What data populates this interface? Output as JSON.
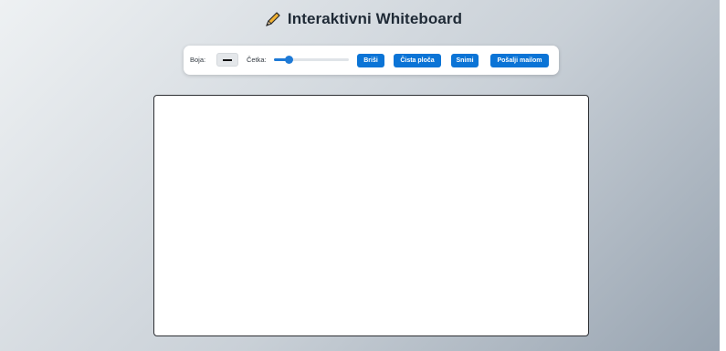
{
  "header": {
    "title": "Interaktivni Whiteboard",
    "icon": "pencil-icon"
  },
  "toolbar": {
    "color_label": "Boja:",
    "color_value": "#111111",
    "brush_label": "Četka:",
    "brush_size_fraction": 0.2,
    "buttons": {
      "erase": "Briši",
      "clear": "Čista ploča",
      "save": "Snimi",
      "email": "Pošalji mailom"
    }
  },
  "colors": {
    "accent": "#0b74d6",
    "board_background": "#ffffff"
  }
}
